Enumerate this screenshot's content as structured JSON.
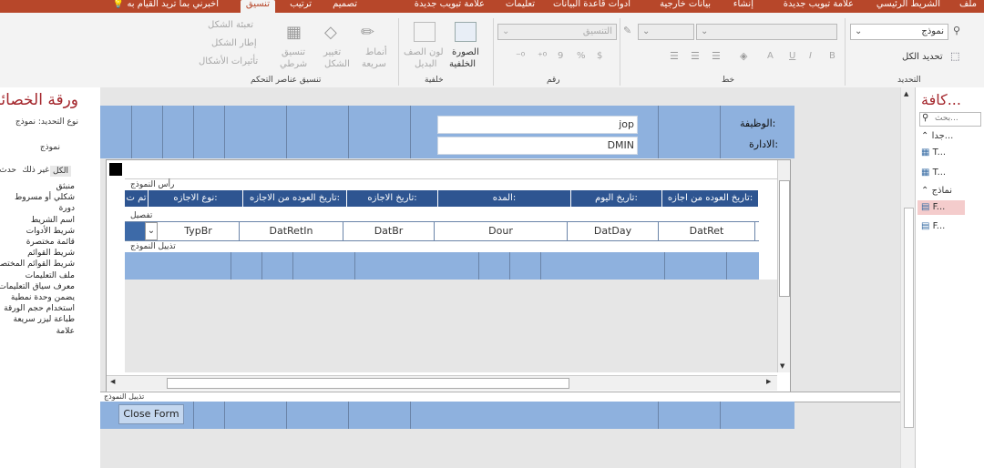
{
  "ribbon_tabs": [
    "ملف",
    "الشريط الرئيسي",
    "علامة تبويب جديدة",
    "إنشاء",
    "بيانات خارجية",
    "أدوات قاعدة البيانات",
    "تعليمات",
    "علامة تبويب جديدة",
    "تصميم",
    "ترتيب",
    "تنسيق"
  ],
  "tell_me": "أخبرني بما تريد القيام به",
  "selection": {
    "combo_value": "نموذج",
    "select_all": "تحديد الكل",
    "group_label": "التحديد"
  },
  "font": {
    "group_label": "خط",
    "btn_b": "B",
    "btn_i": "I",
    "btn_u": "U",
    "btn_a": "A"
  },
  "number": {
    "combo_value": "التنسيق",
    "group_label": "رقم",
    "percent": "%",
    "comma": "9"
  },
  "background": {
    "image_label1": "الصورة",
    "image_label2": "الخلفية",
    "alt_row1": "لون الصف",
    "alt_row2": "البديل",
    "group_label": "خلفية"
  },
  "control_format": {
    "quick_styles1": "أنماط",
    "quick_styles2": "سريعة",
    "change_shape1": "تغيير",
    "change_shape2": "الشكل",
    "cond_format1": "تنسيق",
    "cond_format2": "شرطي",
    "shape_fill": "تعبئة الشكل",
    "shape_outline": "إطار الشكل",
    "shape_effects": "تأثيرات الأشكال",
    "group_label": "تنسيق عناصر التحكم"
  },
  "nav": {
    "title": "كافة...",
    "search_placeholder": "بحث...",
    "tables_header": "جدا...",
    "table1": "T...",
    "table2": "T...",
    "forms_header": "نماذج",
    "form1": "F...",
    "form2": "F..."
  },
  "property_sheet": {
    "title": "ورقة الخصائص",
    "selection_type": "نوع التحديد:  نموذج",
    "selected": "نموذج",
    "tab_all": "الكل",
    "tab_other": "غير ذلك",
    "tab_event": "حدث",
    "items": [
      "منبثق",
      "شكلي أو مسروط",
      "دورة",
      "اسم الشريط",
      "شريط الأدوات",
      "قائمة مختصرة",
      "شريط القوائم",
      "شريط القوائم المختصرة",
      "ملف التعليمات",
      "معرف سياق التعليمات",
      "يضمن وحدة نمطية",
      "استخدام حجم الورقة",
      "طباعة ليزر سريعة",
      "علامة"
    ]
  },
  "main_form": {
    "job_label": "الوظيفة:",
    "job_value": "jop",
    "dept_label": "الادارة:",
    "dept_value": "DMIN",
    "close_button": "Close Form",
    "footer_label": "تذييل النموذج"
  },
  "subform": {
    "header_label": "رأس النموذج",
    "detail_label": "تفصيل",
    "footer_label": "تذييل النموذج",
    "headers": [
      "تاريخ العوده من اجازه:",
      "تاريخ اليوم:",
      "المده:",
      "تاريخ الاجازه:",
      "تاريخ العوده من الاجازه:",
      "نوع الاجازه:",
      "تم ت"
    ],
    "fields": [
      "DatRet",
      "DatDay",
      "Dour",
      "DatBr",
      "DatRetIn",
      "TypBr"
    ]
  }
}
